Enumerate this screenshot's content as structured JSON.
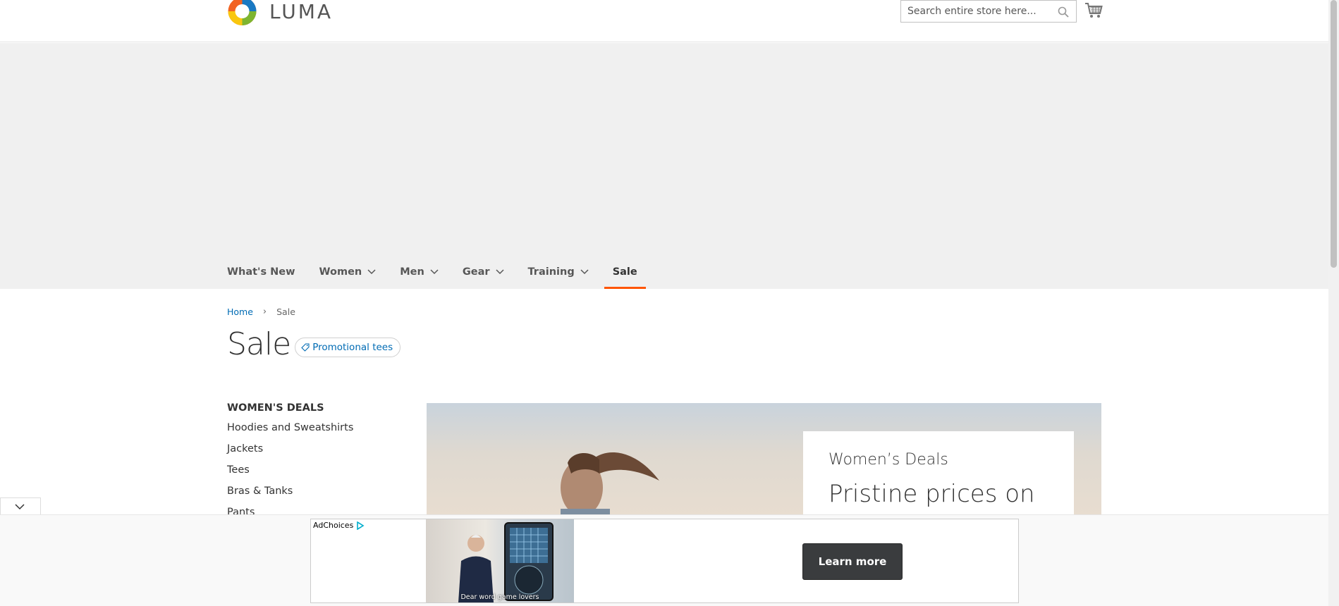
{
  "header": {
    "logo_text": "LUMA",
    "search_placeholder": "Search entire store here...",
    "cart_icon": "cart-icon",
    "search_icon": "magnifier-icon"
  },
  "nav": {
    "items": [
      {
        "label": "What's New",
        "has_dropdown": false
      },
      {
        "label": "Women",
        "has_dropdown": true
      },
      {
        "label": "Men",
        "has_dropdown": true
      },
      {
        "label": "Gear",
        "has_dropdown": true
      },
      {
        "label": "Training",
        "has_dropdown": true
      },
      {
        "label": "Sale",
        "has_dropdown": false,
        "active": true
      }
    ],
    "active_color": "#ff5501"
  },
  "breadcrumb": {
    "home": "Home",
    "separator": "›",
    "current": "Sale"
  },
  "page": {
    "title": "Sale",
    "promo_tag": "Promotional tees"
  },
  "sidebar": {
    "title": "WOMEN'S DEALS",
    "items": [
      "Hoodies and Sweatshirts",
      "Jackets",
      "Tees",
      "Bras & Tanks",
      "Pants"
    ]
  },
  "banner": {
    "subtitle": "Women’s Deals",
    "headline": "Pristine prices on"
  },
  "ad": {
    "adchoices_label": "AdChoices",
    "caption": "Dear word game lovers",
    "cta_label": "Learn more"
  },
  "colors": {
    "link": "#006bb4",
    "hero_background": "#f0f0f0",
    "cta_background": "#3a3c3e"
  }
}
